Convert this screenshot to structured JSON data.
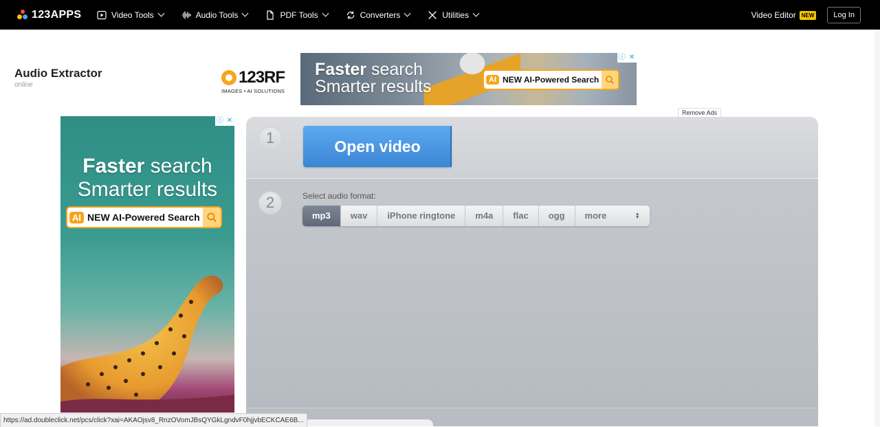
{
  "topbar": {
    "logo": "123APPS",
    "nav": [
      {
        "label": "Video Tools",
        "icon": "play-icon"
      },
      {
        "label": "Audio Tools",
        "icon": "waveform-icon"
      },
      {
        "label": "PDF Tools",
        "icon": "document-icon"
      },
      {
        "label": "Converters",
        "icon": "convert-icon"
      },
      {
        "label": "Utilities",
        "icon": "tools-icon"
      }
    ],
    "video_editor": "Video Editor",
    "new_badge": "NEW",
    "login": "Log In"
  },
  "page": {
    "title": "Audio Extractor",
    "subtitle": "online"
  },
  "ads": {
    "brand_name": "123RF",
    "brand_tag": "IMAGES • AI SOLUTIONS",
    "headline_bold": "Faster",
    "headline_rest": " search",
    "headline_line2": "Smarter results",
    "ai_badge": "AI",
    "pill_text": "NEW AI-Powered Search",
    "remove_ads": "Remove Ads"
  },
  "tool": {
    "step1_num": "1",
    "open_button": "Open video",
    "step2_num": "2",
    "format_label": "Select audio format:",
    "formats": [
      "mp3",
      "wav",
      "iPhone ringtone",
      "m4a",
      "flac",
      "ogg"
    ],
    "more_label": "more",
    "selected_format": "mp3"
  },
  "statusbar": {
    "url": "https://ad.doubleclick.net/pcs/click?xai=AKAOjsv8_RnzOVomJBsQYGkLgndvF0hjjvbECKCAE6B..."
  },
  "colors": {
    "accent_blue": "#3b85d6",
    "ad_orange": "#f7a51c",
    "badge_yellow": "#f2c500"
  }
}
